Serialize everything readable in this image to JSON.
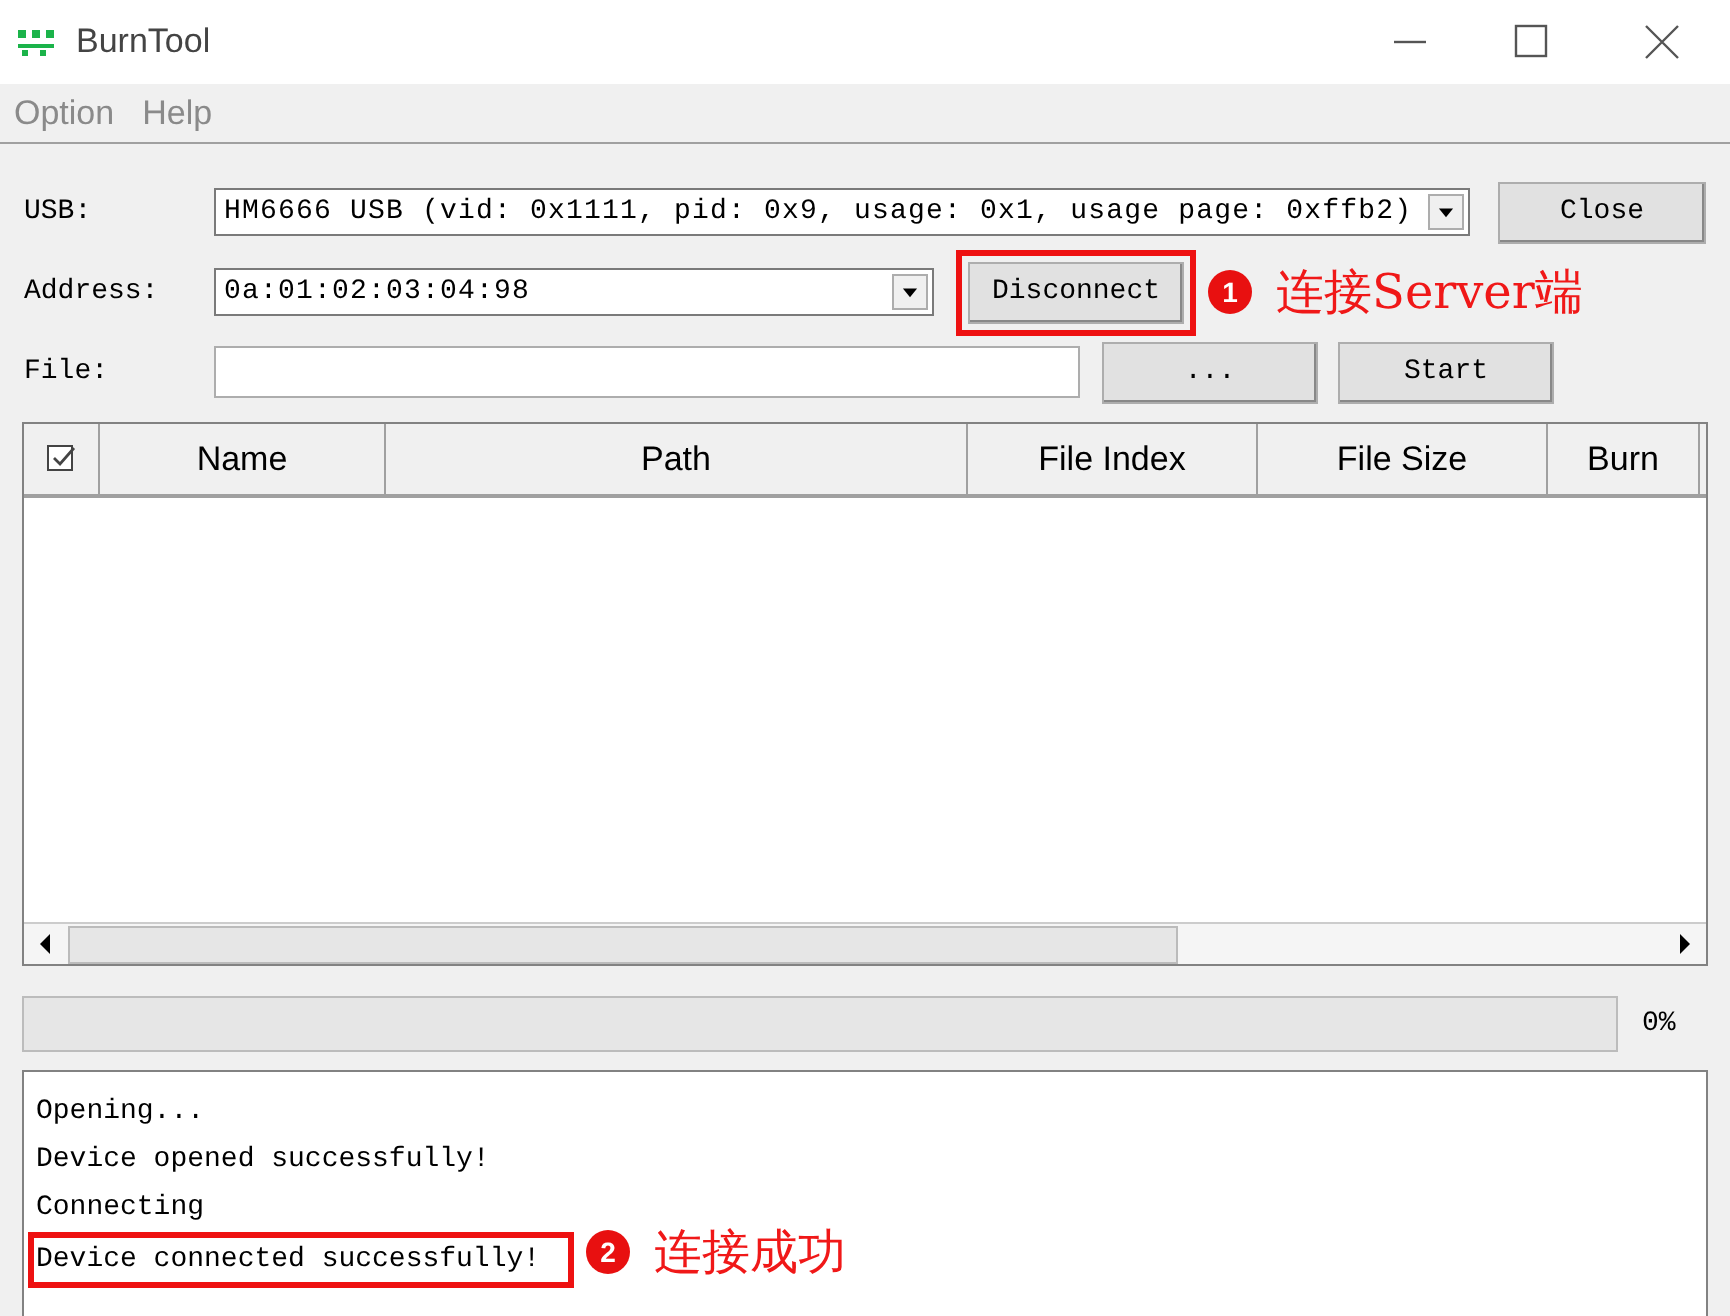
{
  "window": {
    "title": "BurnTool"
  },
  "menu": [
    "Option",
    "Help"
  ],
  "form": {
    "usb": {
      "label": "USB:",
      "value": "HM6666 USB (vid: 0x1111, pid: 0x9, usage: 0x1, usage page: 0xffb2)"
    },
    "close_button": "Close",
    "address": {
      "label": "Address:",
      "value": "0a:01:02:03:04:98"
    },
    "disconnect_button": {
      "label": "Disconnect",
      "highlighted": true,
      "annotation": {
        "number": "1",
        "text": "连接Server端"
      }
    },
    "file": {
      "label": "File:"
    },
    "browse_button": "...",
    "start_button": "Start"
  },
  "table": {
    "columns": [
      "Name",
      "Path",
      "File Index",
      "File Size",
      "Burn"
    ]
  },
  "progress": {
    "level": 0,
    "reading": "0%"
  },
  "log": [
    {
      "text": "Opening...",
      "highlighted": false
    },
    {
      "text": "Device opened successfully!",
      "highlighted": false
    },
    {
      "text": "Connecting",
      "highlighted": false
    },
    {
      "text": "Device connected successfully!",
      "highlighted": true,
      "annotation": {
        "number": "2",
        "text": "连接成功"
      }
    }
  ]
}
